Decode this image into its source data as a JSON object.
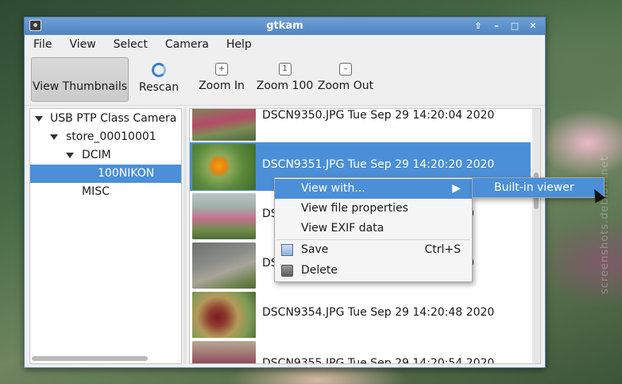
{
  "window": {
    "title": "gtkam",
    "controls": [
      "⇧",
      "–",
      "□",
      "✕"
    ]
  },
  "menubar": {
    "items": [
      "File",
      "View",
      "Select",
      "Camera",
      "Help"
    ]
  },
  "toolbar": {
    "view_thumbnails": "View Thumbnails",
    "rescan": "Rescan",
    "zoom_in": "Zoom In",
    "zoom_100": "Zoom 100",
    "zoom_out": "Zoom Out"
  },
  "tree": {
    "items": [
      {
        "label": "USB PTP Class Camera",
        "expanded": true
      },
      {
        "label": "store_00010001",
        "expanded": true
      },
      {
        "label": "DCIM",
        "expanded": true
      },
      {
        "label": "100NIKON",
        "selected": true
      },
      {
        "label": "MISC"
      }
    ]
  },
  "files": {
    "rows": [
      {
        "name": "DSCN9350.JPG",
        "date": "Tue Sep 29 14:20:04 2020"
      },
      {
        "name": "DSCN9351.JPG",
        "date": "Tue Sep 29 14:20:20 2020",
        "selected": true
      },
      {
        "name": "DS",
        "date": "0"
      },
      {
        "name": "DS",
        "date": "0"
      },
      {
        "name": "DSCN9354.JPG",
        "date": "Tue Sep 29 14:20:48 2020"
      },
      {
        "name": "DSCN9355.JPG",
        "date": "Tue Sep 29 14:20:54 2020"
      }
    ]
  },
  "context_menu": {
    "view_with": "View with...",
    "view_file_properties": "View file properties",
    "view_exif": "View EXIF data",
    "save": "Save",
    "save_shortcut": "Ctrl+S",
    "delete": "Delete"
  },
  "submenu": {
    "builtin_viewer": "Built-in viewer"
  },
  "watermark": "screenshots.debian.net",
  "colors": {
    "selection": "#4a8fd8",
    "titlebar": "#4f84c2"
  }
}
